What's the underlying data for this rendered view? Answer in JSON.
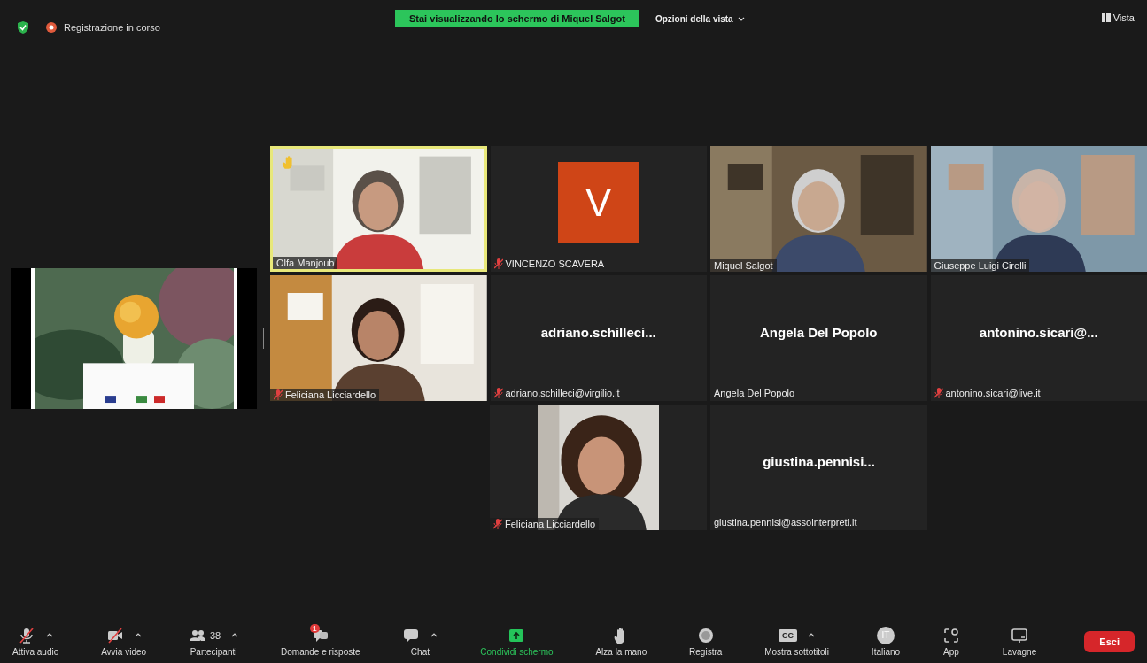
{
  "top_bar": {
    "recording": "Registrazione in corso",
    "banner": "Stai visualizzando lo schermo di Miquel Salgot",
    "view_options": "Opzioni della vista",
    "view_button": "Vista"
  },
  "shared_screen": {
    "kind": "picture"
  },
  "tile_rows": [
    [
      {
        "kind": "video",
        "name": "Olfa Manjoub",
        "muted": false,
        "speaking": true,
        "hand_raised": true
      },
      {
        "kind": "avatar",
        "initial": "V",
        "name": "VINCENZO SCAVERA",
        "muted": true,
        "speaking": false,
        "hand_raised": false
      },
      {
        "kind": "video",
        "name": "Miquel Salgot",
        "muted": false,
        "speaking": false,
        "hand_raised": false
      },
      {
        "kind": "video",
        "name": "Giuseppe Luigi Cirelli",
        "muted": false,
        "speaking": false,
        "hand_raised": false
      }
    ],
    [
      {
        "kind": "video",
        "name": "Feliciana Licciardello",
        "muted": true,
        "speaking": false,
        "hand_raised": false
      },
      {
        "kind": "name",
        "title": "adriano.schilleci...",
        "name": "adriano.schilleci@virgilio.it",
        "muted": true,
        "speaking": false,
        "hand_raised": false
      },
      {
        "kind": "name",
        "title": "Angela Del Popolo",
        "name": "Angela Del Popolo",
        "muted": false,
        "speaking": false,
        "hand_raised": false
      },
      {
        "kind": "name",
        "title": "antonino.sicari@...",
        "name": "antonino.sicari@live.it",
        "muted": true,
        "speaking": false,
        "hand_raised": false
      }
    ],
    [
      {
        "kind": "portrait",
        "name": "Feliciana Licciardello",
        "muted": true,
        "speaking": false,
        "hand_raised": false
      },
      {
        "kind": "name",
        "title": "giustina.pennisi...",
        "name": "giustina.pennisi@assointerpreti.it",
        "muted": false,
        "speaking": false,
        "hand_raised": false
      }
    ]
  ],
  "toolbar": [
    {
      "kind": "mic",
      "label": "Attiva audio",
      "off": true,
      "caret": true
    },
    {
      "kind": "video",
      "label": "Avvia video",
      "off": true,
      "caret": true
    },
    {
      "kind": "participants",
      "label": "Partecipanti",
      "count": "38",
      "caret": true
    },
    {
      "kind": "qa",
      "label": "Domande e risposte",
      "badge": "1"
    },
    {
      "kind": "chat",
      "label": "Chat",
      "caret": true
    },
    {
      "kind": "share",
      "label": "Condividi schermo",
      "highlighted": true
    },
    {
      "kind": "hand",
      "label": "Alza la mano"
    },
    {
      "kind": "record",
      "label": "Registra"
    },
    {
      "kind": "cc",
      "label": "Mostra sottotitoli",
      "icon_text": "CC",
      "caret": true
    },
    {
      "kind": "language",
      "label": "Italiano",
      "icon_text": "IT"
    },
    {
      "kind": "apps",
      "label": "App"
    },
    {
      "kind": "whiteboard",
      "label": "Lavagne"
    }
  ],
  "leave_button": "Esci"
}
